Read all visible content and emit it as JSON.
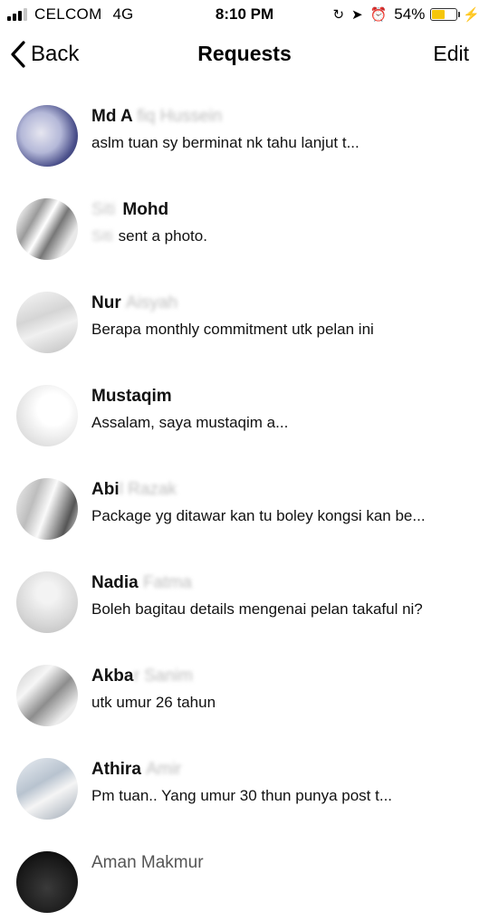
{
  "status_bar": {
    "carrier": "CELCOM",
    "network": "4G",
    "time": "8:10 PM",
    "battery_percent": "54%",
    "battery_level": 0.54,
    "battery_color": "#f5c60a"
  },
  "nav": {
    "back_label": "Back",
    "title": "Requests",
    "edit_label": "Edit"
  },
  "requests": [
    {
      "name": "Md A",
      "name_blur": "fiq Hussein",
      "preview": "aslm tuan sy berminat nk tahu lanjut t..."
    },
    {
      "name_pre": "Siti",
      "name": "Mohd",
      "preview_pre": "Siti",
      "preview": "sent a photo."
    },
    {
      "name": "Nur",
      "name_blur": "Aisyah",
      "preview": "Berapa monthly commitment utk pelan ini"
    },
    {
      "name": "Mustaqim",
      "preview": "Assalam, saya mustaqim a..."
    },
    {
      "name": "Abi",
      "name_blur": "l Razak",
      "preview": "Package yg ditawar kan tu boley kongsi kan be..."
    },
    {
      "name": "Nadia",
      "name_blur": "Fatma",
      "preview": "Boleh bagitau details mengenai pelan takaful ni?"
    },
    {
      "name": "Akba",
      "name_blur": "r Sanim",
      "preview": "utk umur 26 tahun"
    },
    {
      "name": "Athira",
      "name_blur": "Amir",
      "preview": "Pm tuan.. Yang umur 30 thun punya post t..."
    },
    {
      "name": "Aman Makmur",
      "preview": ""
    }
  ]
}
